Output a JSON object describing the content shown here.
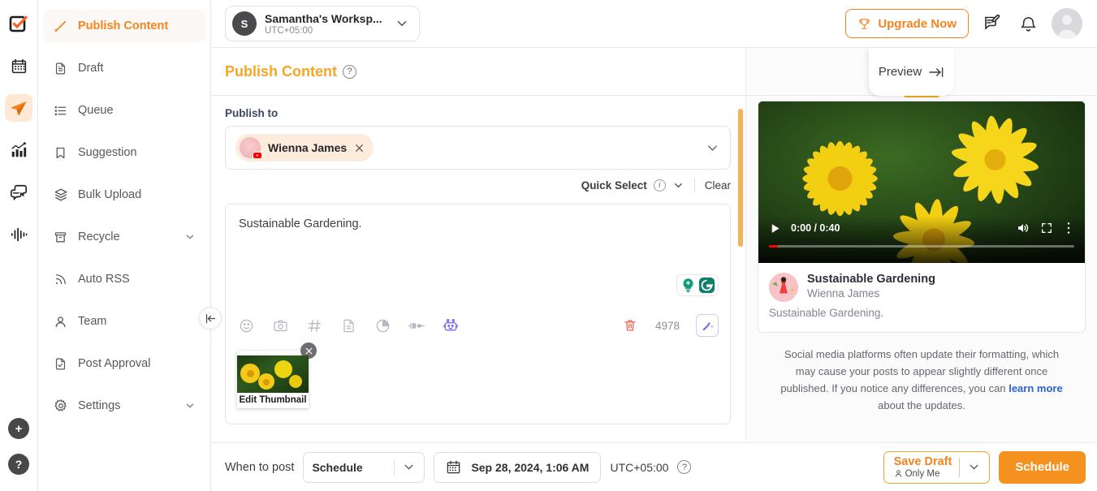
{
  "rail": {
    "logo_icon": "checkbox-arrow-logo",
    "items": [
      {
        "icon": "calendar-icon",
        "name": "calendar",
        "active": false
      },
      {
        "icon": "paper-plane-icon",
        "name": "publish",
        "active": true
      },
      {
        "icon": "analytics-chart-icon",
        "name": "analytics",
        "active": false
      },
      {
        "icon": "chat-bubbles-icon",
        "name": "inbox",
        "active": false
      },
      {
        "icon": "audio-waveform-icon",
        "name": "listening",
        "active": false
      }
    ],
    "add_label": "+",
    "help_label": "?"
  },
  "sidebar": {
    "items": [
      {
        "label": "Publish Content",
        "icon": "pencil-icon",
        "active": true,
        "chevron": false
      },
      {
        "label": "Draft",
        "icon": "document-icon",
        "active": false,
        "chevron": false
      },
      {
        "label": "Queue",
        "icon": "list-icon",
        "active": false,
        "chevron": false
      },
      {
        "label": "Suggestion",
        "icon": "bookmark-icon",
        "active": false,
        "chevron": false
      },
      {
        "label": "Bulk Upload",
        "icon": "layers-icon",
        "active": false,
        "chevron": false
      },
      {
        "label": "Recycle",
        "icon": "archive-icon",
        "active": false,
        "chevron": true
      },
      {
        "label": "Auto RSS",
        "icon": "rss-icon",
        "active": false,
        "chevron": false
      },
      {
        "label": "Team",
        "icon": "user-icon",
        "active": false,
        "chevron": false
      },
      {
        "label": "Post Approval",
        "icon": "document-check-icon",
        "active": false,
        "chevron": false
      },
      {
        "label": "Settings",
        "icon": "gear-icon",
        "active": false,
        "chevron": true
      }
    ],
    "collapse_icon": "collapse-left-icon"
  },
  "topbar": {
    "workspace": {
      "initial": "S",
      "name": "Samantha's Worksp...",
      "timezone": "UTC+05:00",
      "caret_icon": "chevron-down-icon"
    },
    "upgrade": {
      "label": "Upgrade Now",
      "icon": "trophy-icon"
    },
    "icons": [
      {
        "name": "compose-feedback-icon"
      },
      {
        "name": "bell-icon"
      }
    ],
    "avatar": "user-avatar"
  },
  "publish": {
    "title": "Publish Content",
    "help_icon": "question-circle-icon",
    "publish_to_label": "Publish to",
    "chip": {
      "name": "Wienna James",
      "platform": "youtube",
      "remove_icon": "close-icon"
    },
    "select_caret_icon": "chevron-down-icon",
    "quick_select_label": "Quick Select",
    "quick_select_info_icon": "info-circle-icon",
    "quick_select_caret_icon": "chevron-down-icon",
    "clear_label": "Clear",
    "editor_text": "Sustainable Gardening.",
    "assist_icons": [
      "lightbulb-plus-icon",
      "grammarly-icon"
    ],
    "toolbar_icons": [
      "emoji-icon",
      "camera-icon",
      "hashtag-icon",
      "document-icon",
      "chart-pie-icon",
      "plug-icon",
      "robot-icon"
    ],
    "delete_icon": "trash-icon",
    "char_count": "4978",
    "magic_icon": "magic-wand-icon",
    "thumbnail": {
      "caption": "Edit Thumbnail",
      "close_icon": "close-icon"
    }
  },
  "preview": {
    "tab_label": "Preview",
    "tab_icon": "arrow-right-bar-icon",
    "platform_tab": "youtube-icon",
    "video": {
      "play_icon": "play-icon",
      "time": "0:00 / 0:40",
      "volume_icon": "volume-icon",
      "fullscreen_icon": "fullscreen-icon",
      "more_icon": "kebab-menu-icon"
    },
    "meta": {
      "title": "Sustainable Gardening",
      "author": "Wienna James",
      "description": "Sustainable Gardening."
    },
    "disclaimer": {
      "part1": "Social media platforms often update their formatting, which may cause your posts to appear slightly different once published. If you notice any differences, you can ",
      "link": "learn more",
      "part2": " about the updates."
    }
  },
  "bottombar": {
    "when_label": "When to post",
    "schedule_mode": "Schedule",
    "mode_caret_icon": "chevron-down-icon",
    "calendar_icon": "calendar-icon",
    "datetime": "Sep 28, 2024, 1:06 AM",
    "timezone": "UTC+05:00",
    "help_icon": "question-circle-icon",
    "save_draft": {
      "label": "Save Draft",
      "sub_label": "Only Me",
      "person_icon": "person-icon",
      "caret_icon": "chevron-down-icon"
    },
    "primary_button": "Schedule"
  },
  "colors": {
    "accent": "#f5841f",
    "accent_soft": "#f5a623",
    "youtube_red": "#ff0000",
    "link_blue": "#2b62d4",
    "grammarly_green": "#15806a"
  }
}
